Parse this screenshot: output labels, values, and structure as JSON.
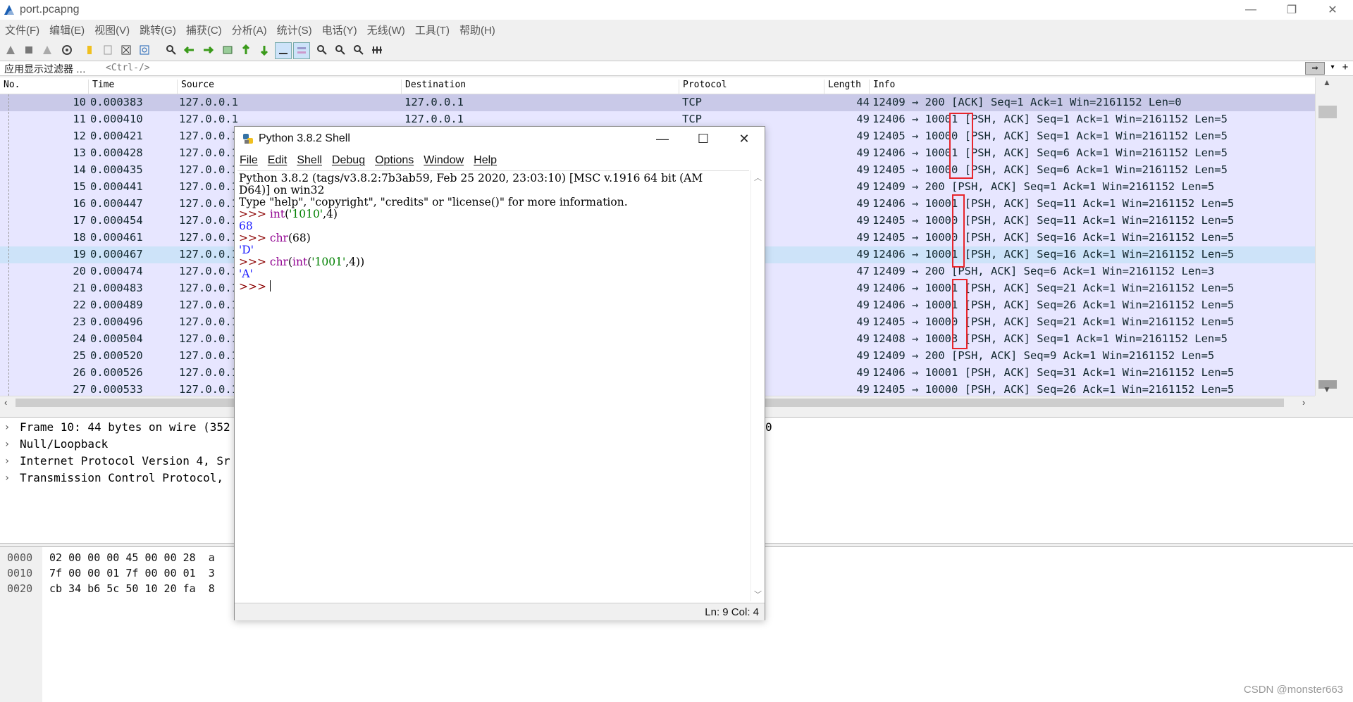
{
  "window": {
    "title": "port.pcapng"
  },
  "menu": [
    "文件(F)",
    "编辑(E)",
    "视图(V)",
    "跳转(G)",
    "捕获(C)",
    "分析(A)",
    "统计(S)",
    "电话(Y)",
    "无线(W)",
    "工具(T)",
    "帮助(H)"
  ],
  "filter": {
    "label": "应用显示过滤器 …",
    "placeholder": "<Ctrl-/>"
  },
  "columns": [
    "No.",
    "Time",
    "Source",
    "Destination",
    "Protocol",
    "Length",
    "Info"
  ],
  "packets": [
    {
      "no": "10",
      "time": "0.000383",
      "src": "127.0.0.1",
      "dst": "127.0.0.1",
      "proto": "TCP",
      "len": "44",
      "info": "12409 → 200 [ACK] Seq=1 Ack=1 Win=2161152 Len=0"
    },
    {
      "no": "11",
      "time": "0.000410",
      "src": "127.0.0.1",
      "dst": "127.0.0.1",
      "proto": "TCP",
      "len": "49",
      "info": "12406 → 10001 [PSH, ACK] Seq=1 Ack=1 Win=2161152 Len=5"
    },
    {
      "no": "12",
      "time": "0.000421",
      "src": "127.0.0.1",
      "dst": "",
      "proto": "",
      "len": "49",
      "info": "12405 → 10000 [PSH, ACK] Seq=1 Ack=1 Win=2161152 Len=5"
    },
    {
      "no": "13",
      "time": "0.000428",
      "src": "127.0.0.1",
      "dst": "",
      "proto": "",
      "len": "49",
      "info": "12406 → 10001 [PSH, ACK] Seq=6 Ack=1 Win=2161152 Len=5"
    },
    {
      "no": "14",
      "time": "0.000435",
      "src": "127.0.0.1",
      "dst": "",
      "proto": "",
      "len": "49",
      "info": "12405 → 10000 [PSH, ACK] Seq=6 Ack=1 Win=2161152 Len=5"
    },
    {
      "no": "15",
      "time": "0.000441",
      "src": "127.0.0.1",
      "dst": "",
      "proto": "",
      "len": "49",
      "info": "12409 → 200 [PSH, ACK] Seq=1 Ack=1 Win=2161152 Len=5"
    },
    {
      "no": "16",
      "time": "0.000447",
      "src": "127.0.0.1",
      "dst": "",
      "proto": "",
      "len": "49",
      "info": "12406 → 10001 [PSH, ACK] Seq=11 Ack=1 Win=2161152 Len=5"
    },
    {
      "no": "17",
      "time": "0.000454",
      "src": "127.0.0.1",
      "dst": "",
      "proto": "",
      "len": "49",
      "info": "12405 → 10000 [PSH, ACK] Seq=11 Ack=1 Win=2161152 Len=5"
    },
    {
      "no": "18",
      "time": "0.000461",
      "src": "127.0.0.1",
      "dst": "",
      "proto": "",
      "len": "49",
      "info": "12405 → 10000 [PSH, ACK] Seq=16 Ack=1 Win=2161152 Len=5"
    },
    {
      "no": "19",
      "time": "0.000467",
      "src": "127.0.0.1",
      "dst": "",
      "proto": "",
      "len": "49",
      "info": "12406 → 10001 [PSH, ACK] Seq=16 Ack=1 Win=2161152 Len=5"
    },
    {
      "no": "20",
      "time": "0.000474",
      "src": "127.0.0.1",
      "dst": "",
      "proto": "",
      "len": "47",
      "info": "12409 → 200 [PSH, ACK] Seq=6 Ack=1 Win=2161152 Len=3"
    },
    {
      "no": "21",
      "time": "0.000483",
      "src": "127.0.0.1",
      "dst": "",
      "proto": "",
      "len": "49",
      "info": "12406 → 10001 [PSH, ACK] Seq=21 Ack=1 Win=2161152 Len=5"
    },
    {
      "no": "22",
      "time": "0.000489",
      "src": "127.0.0.1",
      "dst": "",
      "proto": "",
      "len": "49",
      "info": "12406 → 10001 [PSH, ACK] Seq=26 Ack=1 Win=2161152 Len=5"
    },
    {
      "no": "23",
      "time": "0.000496",
      "src": "127.0.0.1",
      "dst": "",
      "proto": "",
      "len": "49",
      "info": "12405 → 10000 [PSH, ACK] Seq=21 Ack=1 Win=2161152 Len=5"
    },
    {
      "no": "24",
      "time": "0.000504",
      "src": "127.0.0.1",
      "dst": "",
      "proto": "",
      "len": "49",
      "info": "12408 → 10003 [PSH, ACK] Seq=1 Ack=1 Win=2161152 Len=5"
    },
    {
      "no": "25",
      "time": "0.000520",
      "src": "127.0.0.1",
      "dst": "",
      "proto": "",
      "len": "49",
      "info": "12409 → 200 [PSH, ACK] Seq=9 Ack=1 Win=2161152 Len=5"
    },
    {
      "no": "26",
      "time": "0.000526",
      "src": "127.0.0.1",
      "dst": "",
      "proto": "",
      "len": "49",
      "info": "12406 → 10001 [PSH, ACK] Seq=31 Ack=1 Win=2161152 Len=5"
    },
    {
      "no": "27",
      "time": "0.000533",
      "src": "127.0.0.1",
      "dst": "",
      "proto": "",
      "len": "49",
      "info": "12405 → 10000 [PSH, ACK] Seq=26 Ack=1 Win=2161152 Len=5"
    }
  ],
  "details": [
    "Frame 10: 44 bytes on wire (352",
    "Null/Loopback",
    "Internet Protocol Version 4, Sr",
    "Transmission Control Protocol,"
  ],
  "detail_tail": "0",
  "bytes": [
    {
      "offset": "0000",
      "hex": "02 00 00 00 45 00 00 28  a"
    },
    {
      "offset": "0010",
      "hex": "7f 00 00 01 7f 00 00 01  3"
    },
    {
      "offset": "0020",
      "hex": "cb 34 b6 5c 50 10 20 fa  8"
    }
  ],
  "watermark": "CSDN @monster663",
  "shell": {
    "title": "Python 3.8.2 Shell",
    "menu": [
      "File",
      "Edit",
      "Shell",
      "Debug",
      "Options",
      "Window",
      "Help"
    ],
    "banner1": "Python 3.8.2 (tags/v3.8.2:7b3ab59, Feb 25 2020, 23:03:10) [MSC v.1916 64 bit (AM",
    "banner2": "D64)] on win32",
    "banner3": "Type \"help\", \"copyright\", \"credits\" or \"license()\" for more information.",
    "prompt": ">>> ",
    "cmd1_fn": "int",
    "cmd1_rest": "(",
    "cmd1_str": "'1010'",
    "cmd1_end": ",4)",
    "out1": "68",
    "cmd2_fn": "chr",
    "cmd2_rest": "(68)",
    "out2": "'D'",
    "cmd3_fn1": "chr",
    "cmd3_p": "(",
    "cmd3_fn2": "int",
    "cmd3_p2": "(",
    "cmd3_str": "'1001'",
    "cmd3_end": ",4))",
    "out3": "'A'",
    "status": "Ln: 9   Col: 4"
  }
}
